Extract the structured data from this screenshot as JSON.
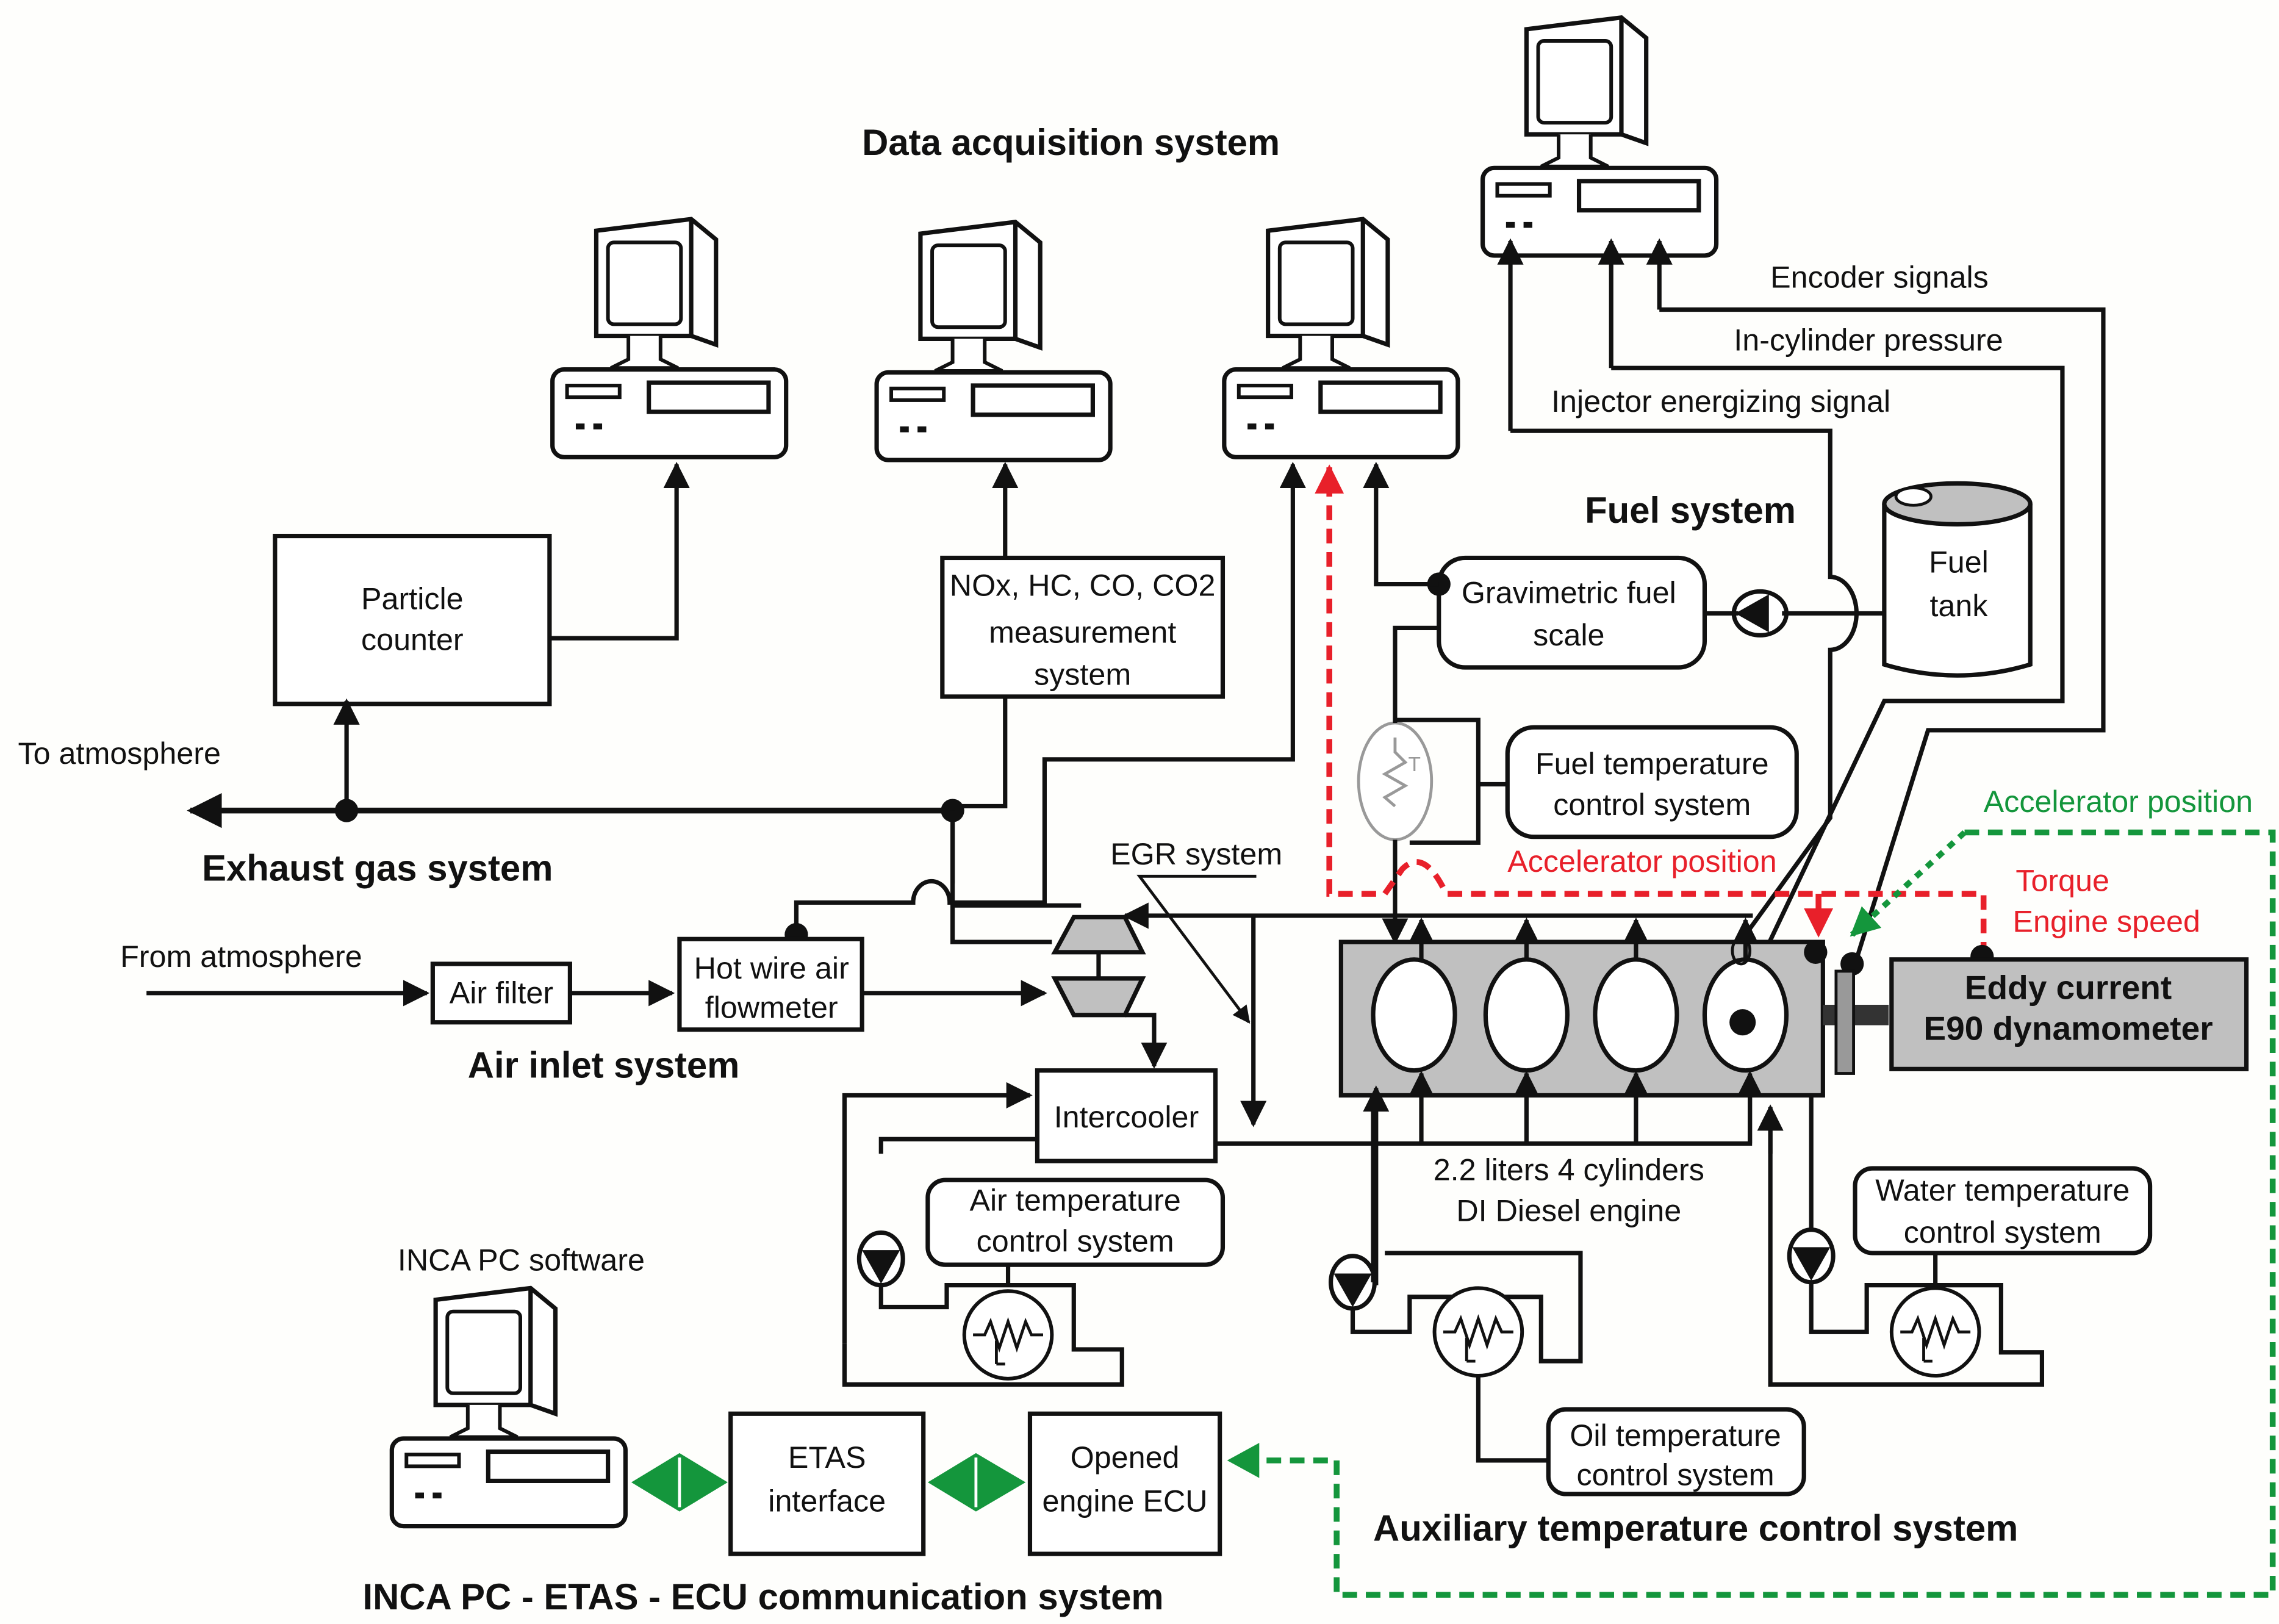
{
  "title": "Data acquisition system",
  "sections": {
    "exhaust": "Exhaust gas system",
    "air_inlet": "Air inlet system",
    "fuel": "Fuel system",
    "aux_temp": "Auxiliary  temperature control system",
    "comm": "INCA PC - ETAS - ECU communication system"
  },
  "labels": {
    "to_atmosphere": "To atmosphere",
    "from_atmosphere": "From atmosphere",
    "egr": "EGR system",
    "encoder": "Encoder signals",
    "in_cylinder": "In-cylinder pressure",
    "injector": "Injector energizing signal",
    "inca_software": "INCA PC software",
    "engine_line1": "2.2 liters 4 cylinders",
    "engine_line2": "DI Diesel engine",
    "accel_red": "Accelerator position",
    "accel_green": "Accelerator position",
    "torque": "Torque",
    "engine_speed": "Engine speed",
    "thermo_symbol": "T"
  },
  "boxes": {
    "particle_counter": [
      "Particle",
      "counter"
    ],
    "emissions": [
      "NOx, HC, CO, CO2",
      "measurement",
      "system"
    ],
    "gravimetric": [
      "Gravimetric fuel",
      "scale"
    ],
    "fuel_tank": [
      "Fuel",
      "tank"
    ],
    "fuel_temp": [
      "Fuel temperature",
      "control system"
    ],
    "air_filter": [
      "Air filter"
    ],
    "hot_wire": [
      "Hot wire air",
      "flowmeter"
    ],
    "intercooler": [
      "Intercooler"
    ],
    "air_temp": [
      "Air temperature",
      "control system"
    ],
    "water_temp": [
      "Water temperature",
      "control system"
    ],
    "oil_temp": [
      "Oil temperature",
      "control system"
    ],
    "dynamometer": [
      "Eddy current",
      "E90 dynamometer"
    ],
    "etas": [
      "ETAS",
      "interface"
    ],
    "ecu": [
      "Opened",
      "engine ECU"
    ]
  },
  "colors": {
    "signal_red": "#e8202a",
    "signal_green": "#14963c",
    "component_gray": "#c0c0c0"
  }
}
